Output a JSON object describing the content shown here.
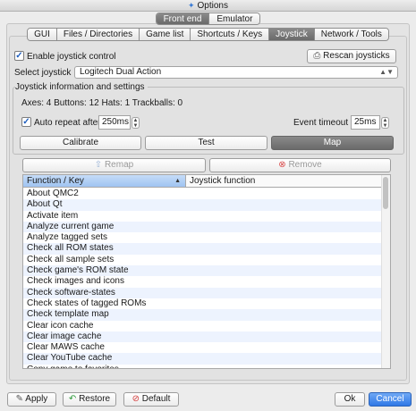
{
  "window": {
    "title": "Options"
  },
  "top_tabs": [
    {
      "label": "Front end",
      "active": true
    },
    {
      "label": "Emulator",
      "active": false
    }
  ],
  "sub_tabs": [
    {
      "label": "GUI",
      "active": false
    },
    {
      "label": "Files / Directories",
      "active": false
    },
    {
      "label": "Game list",
      "active": false
    },
    {
      "label": "Shortcuts / Keys",
      "active": false
    },
    {
      "label": "Joystick",
      "active": true
    },
    {
      "label": "Network / Tools",
      "active": false
    }
  ],
  "joystick": {
    "enable_label": "Enable joystick control",
    "rescan_label": "Rescan joysticks",
    "select_label": "Select joystick",
    "selected_joystick": "Logitech Dual Action",
    "info_title": "Joystick information and settings",
    "axes_text": "Axes: 4  Buttons: 12  Hats: 1  Trackballs: 0",
    "auto_repeat_label": "Auto repeat after",
    "auto_repeat_value": "250ms",
    "event_timeout_label": "Event timeout",
    "event_timeout_value": "25ms",
    "calibrate_label": "Calibrate",
    "test_label": "Test",
    "map_label": "Map",
    "remap_label": "Remap",
    "remove_label": "Remove"
  },
  "table": {
    "columns": [
      "Function / Key",
      "Joystick function"
    ],
    "rows": [
      "About QMC2",
      "About Qt",
      "Activate item",
      "Analyze current game",
      "Analyze tagged sets",
      "Check all ROM states",
      "Check all sample sets",
      "Check game's ROM state",
      "Check images and icons",
      "Check software-states",
      "Check states of tagged ROMs",
      "Check template map",
      "Clear icon cache",
      "Clear image cache",
      "Clear MAWS cache",
      "Clear YouTube cache",
      "Copy game to favorites"
    ]
  },
  "footer": {
    "apply_label": "Apply",
    "restore_label": "Restore",
    "default_label": "Default",
    "ok_label": "Ok",
    "cancel_label": "Cancel"
  },
  "colors": {
    "accent": "#2f78e6",
    "selected_header": "#b5d1f5"
  }
}
